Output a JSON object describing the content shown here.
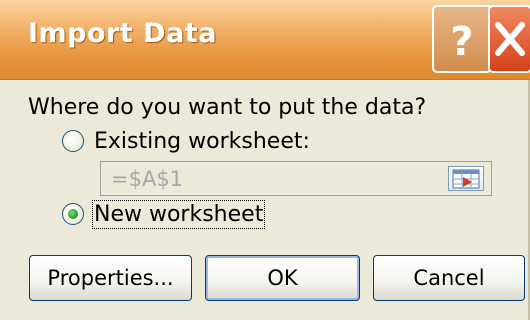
{
  "window": {
    "title": "Import Data"
  },
  "titlebar": {
    "help_glyph": "?",
    "help_icon": "question-mark-icon",
    "close_icon": "close-x-icon"
  },
  "prompt": "Where do you want to put the data?",
  "options": {
    "existing": {
      "label": "Existing worksheet:",
      "checked": false
    },
    "new": {
      "label": "New worksheet",
      "checked": true
    }
  },
  "reference": {
    "value": "=$A$1",
    "icon": "collapse-dialog-icon"
  },
  "buttons": {
    "properties": "Properties...",
    "ok": "OK",
    "cancel": "Cancel"
  },
  "colors": {
    "titlebar": "#e6963f",
    "dialog_bg": "#ece9d8",
    "close_button": "#d4401a"
  }
}
